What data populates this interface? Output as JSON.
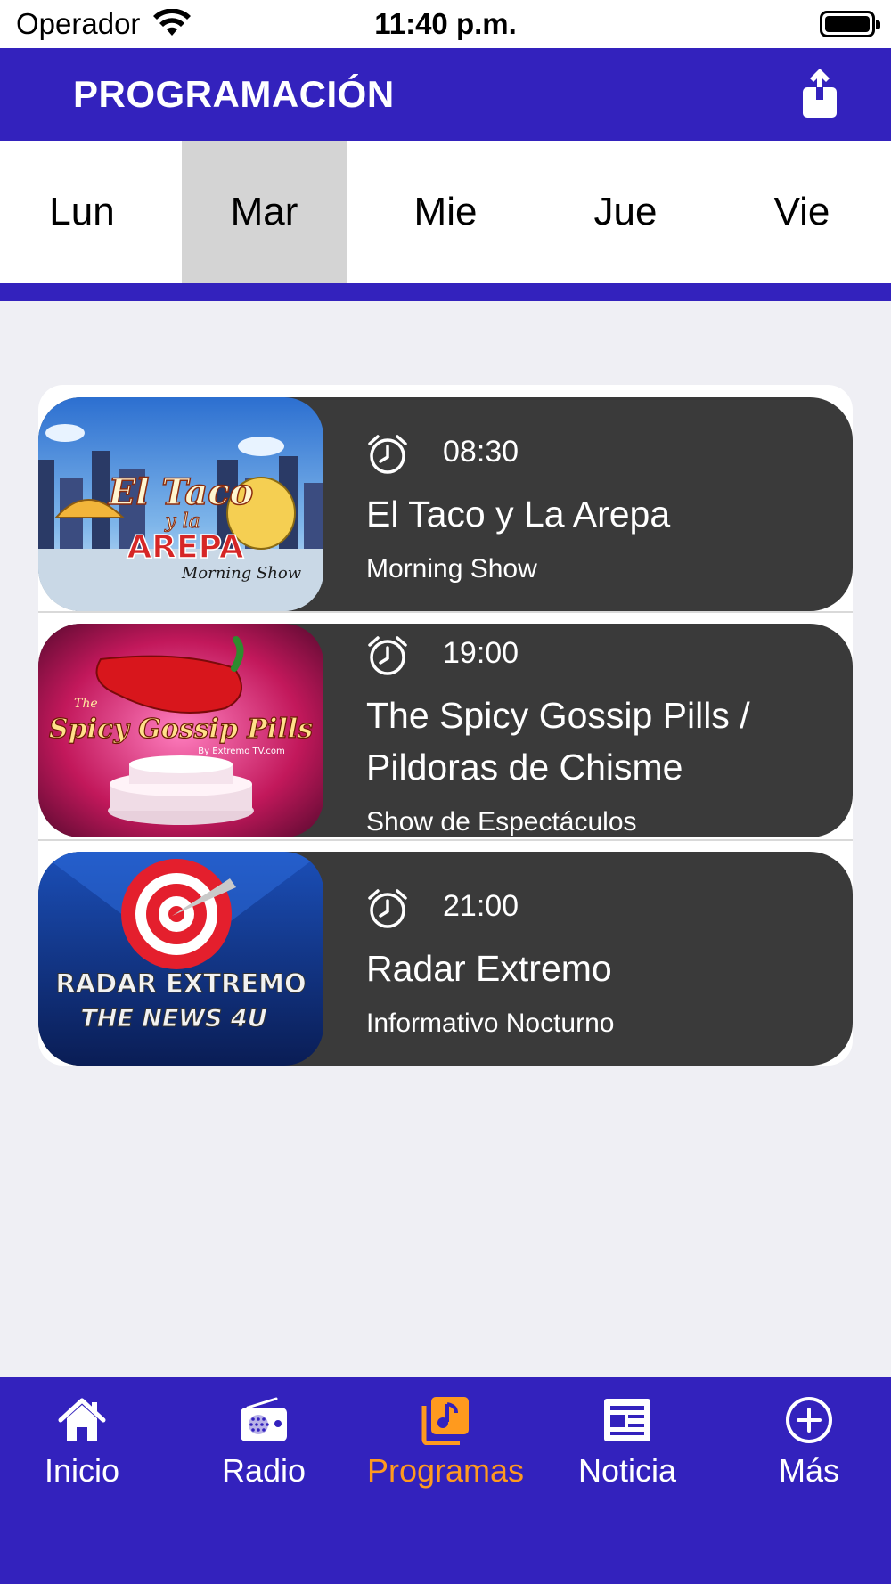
{
  "status": {
    "carrier": "Operador",
    "time": "11:40 p.m."
  },
  "header": {
    "title": "PROGRAMACIÓN"
  },
  "days": [
    {
      "label": "Lun",
      "selected": false
    },
    {
      "label": "Mar",
      "selected": true
    },
    {
      "label": "Mie",
      "selected": false
    },
    {
      "label": "Jue",
      "selected": false
    },
    {
      "label": "Vie",
      "selected": false
    }
  ],
  "programs": [
    {
      "time": "08:30",
      "title": "El Taco y La Arepa",
      "subtitle": "Morning Show",
      "thumb_text": [
        "El Taco",
        "y la",
        "AREPA",
        "Morning Show"
      ]
    },
    {
      "time": "19:00",
      "title": "The Spicy Gossip Pills / Pildoras de Chisme",
      "subtitle": "Show de Espectáculos",
      "thumb_text": [
        "The",
        "Spicy Gossip Pills",
        "By Extremo TV.com"
      ]
    },
    {
      "time": "21:00",
      "title": "Radar Extremo",
      "subtitle": "Informativo Nocturno",
      "thumb_text": [
        "RADAR EXTREMO",
        "THE NEWS 4U"
      ]
    }
  ],
  "tabbar": [
    {
      "label": "Inicio",
      "icon": "home-icon",
      "active": false
    },
    {
      "label": "Radio",
      "icon": "radio-icon",
      "active": false
    },
    {
      "label": "Programas",
      "icon": "music-note-icon",
      "active": true
    },
    {
      "label": "Noticia",
      "icon": "newspaper-icon",
      "active": false
    },
    {
      "label": "Más",
      "icon": "plus-circle-icon",
      "active": false
    }
  ],
  "colors": {
    "brand": "#3322bd",
    "card": "#3a3a3a",
    "active_tab": "#ff9a1e",
    "background": "#efeff4"
  }
}
